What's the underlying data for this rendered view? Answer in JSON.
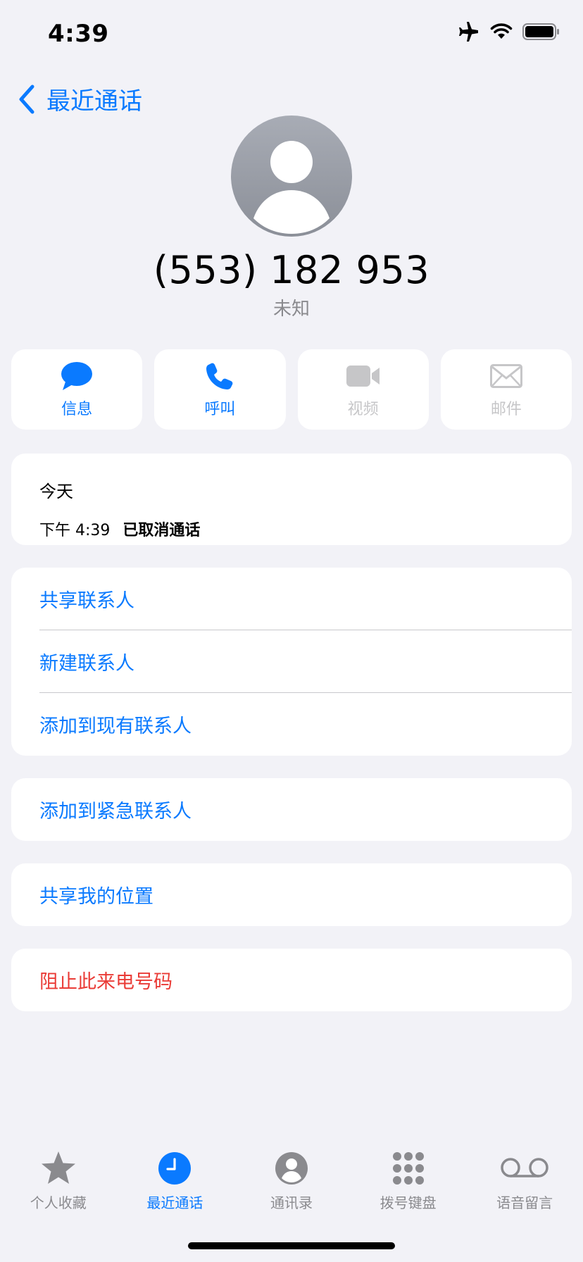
{
  "status_bar": {
    "time": "4:39",
    "icons": [
      "airplane-icon",
      "wifi-icon",
      "battery-icon"
    ]
  },
  "nav": {
    "back_label": "最近通话"
  },
  "contact": {
    "phone_number": "(553) 182 953",
    "label": "未知"
  },
  "actions": [
    {
      "label": "信息",
      "icon": "message-icon",
      "enabled": true
    },
    {
      "label": "呼叫",
      "icon": "phone-icon",
      "enabled": true
    },
    {
      "label": "视频",
      "icon": "video-icon",
      "enabled": false
    },
    {
      "label": "邮件",
      "icon": "mail-icon",
      "enabled": false
    }
  ],
  "recent": {
    "day": "今天",
    "time": "下午 4:39",
    "status": "已取消通话"
  },
  "menu": {
    "share_contact": "共享联系人",
    "new_contact": "新建联系人",
    "add_existing": "添加到现有联系人",
    "add_emergency": "添加到紧急联系人",
    "share_location": "共享我的位置",
    "block_caller": "阻止此来电号码"
  },
  "tabs": [
    {
      "label": "个人收藏",
      "icon": "star-icon",
      "active": false
    },
    {
      "label": "最近通话",
      "icon": "clock-icon",
      "active": true
    },
    {
      "label": "通讯录",
      "icon": "contacts-icon",
      "active": false
    },
    {
      "label": "拨号键盘",
      "icon": "keypad-icon",
      "active": false
    },
    {
      "label": "语音留言",
      "icon": "voicemail-icon",
      "active": false
    }
  ],
  "colors": {
    "accent": "#0a7aff",
    "danger": "#ea3b36",
    "background": "#f2f2f7",
    "disabled": "#c6c6c8",
    "inactive_tab": "#8a8a8e"
  }
}
